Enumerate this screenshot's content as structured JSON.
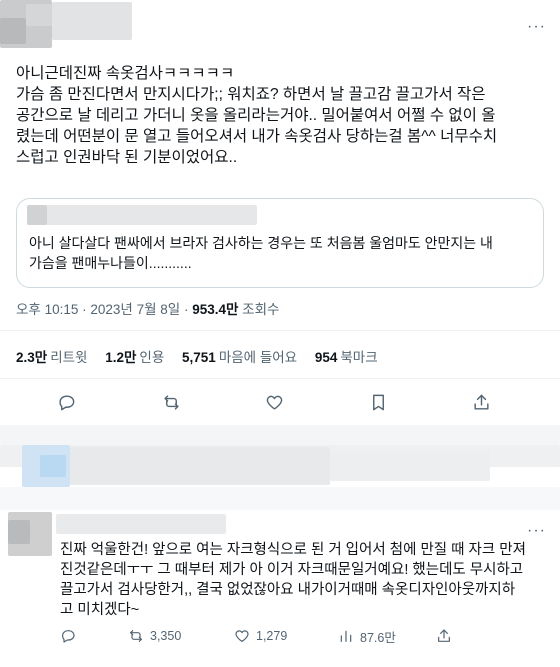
{
  "tweet": {
    "more_label": "···",
    "body_lines": [
      "아니근데진짜 속옷검사ㅋㅋㅋㅋㅋ",
      "가슴 좀 만진다면서 만지시다가;; 워치죠? 하면서 날 끌고감 끌고가서 작은",
      "공간으로 날 데리고 가더니 옷을 올리라는거야.. 밀어붙여서 어쩔 수 없이 올",
      "렸는데 어떤분이 문 열고 들어오셔서 내가 속옷검사 당하는걸 봄^^ 너무수치",
      "스럽고 인권바닥 된 기분이었어요.."
    ],
    "quote_lines": [
      "아니 살다살다 팬싸에서 브라자 검사하는 경우는 또 처음봄 울엄마도 안만지는 내",
      "가슴을 팬매누나들이..........."
    ],
    "meta": {
      "time": "오후 10:15",
      "sep": " · ",
      "date": "2023년 7월 8일",
      "views_count": "953.4만",
      "views_label": "조회수"
    },
    "stats": [
      {
        "count": "2.3만",
        "label": "리트윗"
      },
      {
        "count": "1.2만",
        "label": "인용"
      },
      {
        "count": "5,751",
        "label": "마음에 들어요"
      },
      {
        "count": "954",
        "label": "북마크"
      }
    ]
  },
  "reply": {
    "more_label": "···",
    "lines": [
      "진짜 억울한건! 앞으로 여는 자크형식으로 된 거 입어서 첨에 만질 때 자크 만져",
      "진것같은데ㅜㅜ 그 때부터 제가 아 이거 자크때문일거예요! 했는데도 무시하고",
      "끌고가서 검사당한거,, 결국 없었잖아요 내가이거때매 속옷디자인아웃까지하",
      "고 미치겠다~"
    ],
    "retweets": "3,350",
    "likes": "1,279",
    "views": "87.6만"
  },
  "icons": [
    "reply-icon",
    "retweet-icon",
    "like-icon",
    "bookmark-icon",
    "share-icon",
    "views-icon"
  ]
}
